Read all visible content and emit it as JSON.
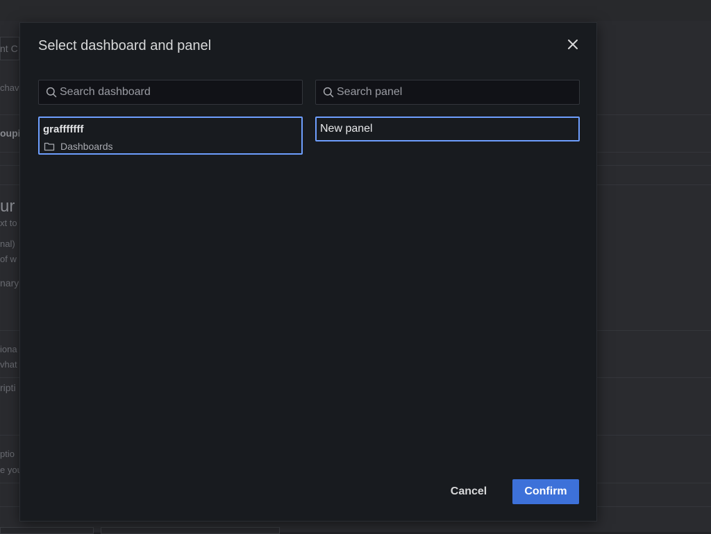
{
  "background": {
    "fragments": [
      "nt C",
      "chav",
      "oupi",
      "ur",
      "xt to",
      "nal)",
      "of w",
      "nary",
      "iona",
      "vhat",
      "ripti",
      "ptio",
      "e you"
    ]
  },
  "modal": {
    "title": "Select dashboard and panel",
    "close_icon": "close-icon",
    "dashboard_search": {
      "placeholder": "Search dashboard",
      "value": ""
    },
    "panel_search": {
      "placeholder": "Search panel",
      "value": ""
    },
    "dashboards": [
      {
        "title": "grafffffff",
        "folder": "Dashboards"
      }
    ],
    "panels": [
      {
        "title": "New panel"
      }
    ],
    "cancel_label": "Cancel",
    "confirm_label": "Confirm"
  },
  "colors": {
    "accent": "#3d71d9",
    "selection_border": "#6e9fff",
    "modal_bg": "#181b1f"
  }
}
